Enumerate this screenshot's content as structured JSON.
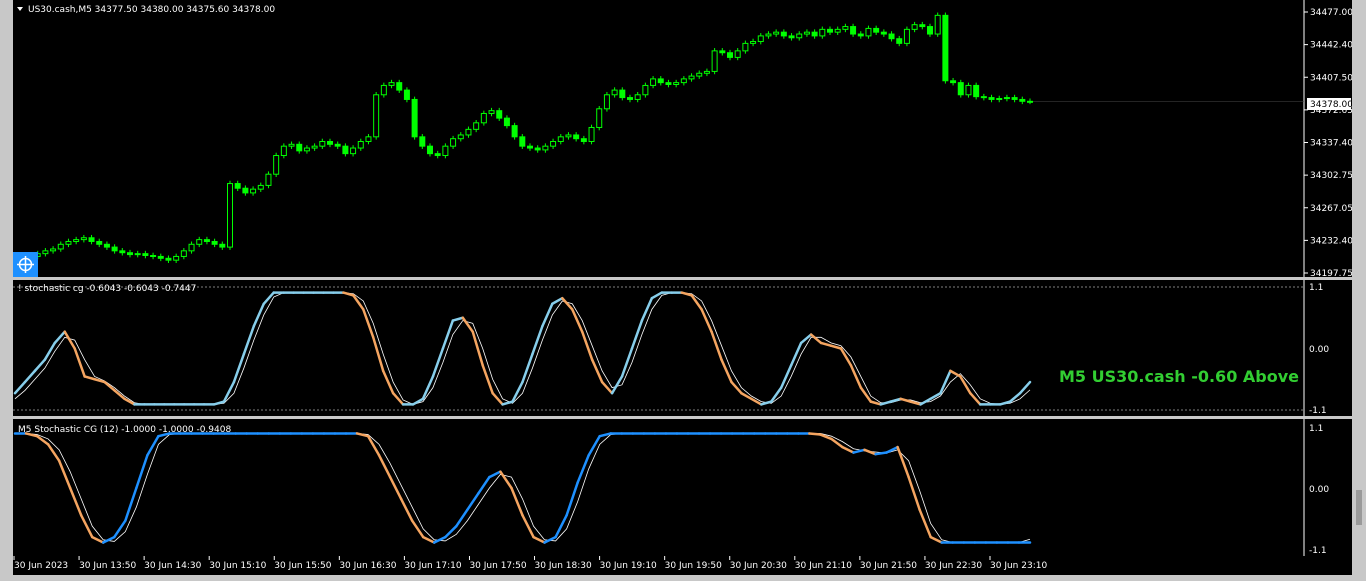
{
  "colors": {
    "background": "#000000",
    "frame": "#c8c8c8",
    "bull_candle": "#00ff00",
    "grid_text": "#ffffff",
    "stoch_main": "#87ceeb",
    "stoch_main_alt": "#1e90ff",
    "stoch_down": "#f4a460",
    "stoch_signal": "#ffffff",
    "signal_text": "#32cd32",
    "widget": "#1e90ff"
  },
  "main_panel": {
    "header": "US30.cash,M5  34377.50 34380.00 34375.60 34378.00",
    "header_icon": "triangle-down-icon",
    "crosshair_icon": "crosshair-icon",
    "price_labels": [
      "34477.00",
      "34442.40",
      "34407.50",
      "34372.65",
      "34337.40",
      "34302.75",
      "34267.05",
      "34232.40",
      "34197.75"
    ],
    "current_price": "34378.00"
  },
  "indicator1": {
    "header": "! stochastic cg -0.6043 -0.6043 -0.7447",
    "levels": [
      "1.1",
      "0.00",
      "-1.1"
    ],
    "signal_text": "M5 US30.cash -0.60 Above"
  },
  "indicator2": {
    "header": "M5 Stochastic CG (12) -1.0000 -1.0000 -0.9408",
    "levels": [
      "1.1",
      "0.00",
      "-1.1"
    ]
  },
  "time_axis": [
    "30 Jun 2023",
    "30 Jun 13:50",
    "30 Jun 14:30",
    "30 Jun 15:10",
    "30 Jun 15:50",
    "30 Jun 16:30",
    "30 Jun 17:10",
    "30 Jun 17:50",
    "30 Jun 18:30",
    "30 Jun 19:10",
    "30 Jun 19:50",
    "30 Jun 20:30",
    "30 Jun 21:10",
    "30 Jun 21:50",
    "30 Jun 22:30",
    "30 Jun 23:10"
  ],
  "chart_data": [
    {
      "type": "candlestick",
      "symbol": "US30.cash",
      "timeframe": "M5",
      "ylim": [
        34190,
        34480
      ],
      "close": [
        34212,
        34215,
        34218,
        34220,
        34225,
        34228,
        34230,
        34232,
        34228,
        34225,
        34222,
        34218,
        34216,
        34214,
        34215,
        34213,
        34212,
        34210,
        34208,
        34212,
        34218,
        34225,
        34230,
        34228,
        34225,
        34222,
        34290,
        34285,
        34280,
        34284,
        34288,
        34300,
        34320,
        34330,
        34332,
        34325,
        34328,
        34330,
        34335,
        34332,
        34330,
        34322,
        34328,
        34335,
        34340,
        34385,
        34395,
        34398,
        34390,
        34380,
        34340,
        34330,
        34322,
        34320,
        34330,
        34338,
        34342,
        34348,
        34355,
        34365,
        34368,
        34360,
        34352,
        34340,
        34330,
        34328,
        34326,
        34330,
        34335,
        34340,
        34342,
        34338,
        34335,
        34350,
        34370,
        34385,
        34390,
        34382,
        34380,
        34385,
        34395,
        34402,
        34398,
        34396,
        34398,
        34402,
        34405,
        34408,
        34410,
        34432,
        34430,
        34425,
        34432,
        34440,
        34442,
        34448,
        34450,
        34452,
        34448,
        34446,
        34450,
        34452,
        34448,
        34455,
        34452,
        34455,
        34458,
        34450,
        34448,
        34456,
        34452,
        34450,
        34445,
        34440,
        34455,
        34460,
        34458,
        34450,
        34470,
        34400,
        34398,
        34385,
        34395,
        34383,
        34382,
        34380,
        34381,
        34382,
        34380,
        34378,
        34378
      ],
      "last": {
        "open": 34377.5,
        "high": 34380.0,
        "low": 34375.6,
        "close": 34378.0
      }
    },
    {
      "type": "line",
      "name": "! stochastic cg",
      "ylim": [
        -1.1,
        1.1
      ],
      "values": {
        "main": -0.6043,
        "signal": -0.6043,
        "trigger": -0.7447
      },
      "series_main": [
        -0.8,
        -0.6,
        -0.4,
        -0.2,
        0.1,
        0.3,
        0.0,
        -0.5,
        -0.55,
        -0.6,
        -0.75,
        -0.9,
        -1.0,
        -1.0,
        -1.0,
        -1.0,
        -1.0,
        -1.0,
        -1.0,
        -1.0,
        -1.0,
        -0.95,
        -0.6,
        -0.1,
        0.4,
        0.8,
        1.0,
        1.0,
        1.0,
        1.0,
        1.0,
        1.0,
        1.0,
        1.0,
        0.95,
        0.7,
        0.2,
        -0.4,
        -0.8,
        -1.0,
        -1.0,
        -0.9,
        -0.5,
        0.0,
        0.5,
        0.55,
        0.3,
        -0.3,
        -0.8,
        -1.0,
        -0.95,
        -0.6,
        -0.1,
        0.4,
        0.8,
        0.9,
        0.7,
        0.3,
        -0.2,
        -0.6,
        -0.8,
        -0.5,
        0.0,
        0.5,
        0.9,
        1.0,
        1.0,
        1.0,
        0.95,
        0.7,
        0.3,
        -0.2,
        -0.6,
        -0.8,
        -0.9,
        -1.0,
        -0.95,
        -0.7,
        -0.3,
        0.1,
        0.25,
        0.1,
        0.05,
        0.0,
        -0.3,
        -0.7,
        -0.95,
        -1.0,
        -0.95,
        -0.9,
        -0.95,
        -1.0,
        -0.9,
        -0.8,
        -0.4,
        -0.5,
        -0.8,
        -1.0,
        -1.0,
        -1.0,
        -0.95,
        -0.8,
        -0.6
      ],
      "series_signal": [
        -0.9,
        -0.75,
        -0.55,
        -0.35,
        -0.05,
        0.2,
        0.15,
        -0.2,
        -0.5,
        -0.58,
        -0.7,
        -0.85,
        -0.97,
        -1.0,
        -1.0,
        -1.0,
        -1.0,
        -1.0,
        -1.0,
        -1.0,
        -1.0,
        -0.98,
        -0.8,
        -0.35,
        0.15,
        0.6,
        0.92,
        1.0,
        1.0,
        1.0,
        1.0,
        1.0,
        1.0,
        1.0,
        0.98,
        0.85,
        0.45,
        -0.1,
        -0.6,
        -0.92,
        -1.0,
        -0.95,
        -0.7,
        -0.25,
        0.25,
        0.5,
        0.45,
        0.0,
        -0.55,
        -0.9,
        -0.98,
        -0.8,
        -0.35,
        0.15,
        0.6,
        0.85,
        0.8,
        0.5,
        0.05,
        -0.4,
        -0.7,
        -0.65,
        -0.25,
        0.25,
        0.7,
        0.95,
        1.0,
        1.0,
        0.98,
        0.85,
        0.5,
        0.05,
        -0.4,
        -0.7,
        -0.85,
        -0.95,
        -0.98,
        -0.85,
        -0.5,
        -0.1,
        0.2,
        0.2,
        0.1,
        0.05,
        -0.15,
        -0.5,
        -0.85,
        -0.97,
        -0.97,
        -0.92,
        -0.92,
        -0.97,
        -0.95,
        -0.85,
        -0.6,
        -0.45,
        -0.65,
        -0.9,
        -0.98,
        -1.0,
        -0.98,
        -0.9,
        -0.74
      ]
    },
    {
      "type": "line",
      "name": "M5 Stochastic CG (12)",
      "ylim": [
        -1.1,
        1.1
      ],
      "values": {
        "main": -1.0,
        "signal": -1.0,
        "trigger": -0.9408
      },
      "series_main": [
        1.0,
        1.0,
        0.95,
        0.8,
        0.5,
        0.0,
        -0.5,
        -0.9,
        -1.0,
        -0.9,
        -0.6,
        0.0,
        0.6,
        0.95,
        1.0,
        1.0,
        1.0,
        1.0,
        1.0,
        1.0,
        1.0,
        1.0,
        1.0,
        1.0,
        1.0,
        1.0,
        1.0,
        1.0,
        1.0,
        1.0,
        1.0,
        1.0,
        0.95,
        0.6,
        0.2,
        -0.2,
        -0.6,
        -0.9,
        -1.0,
        -0.9,
        -0.7,
        -0.4,
        -0.1,
        0.2,
        0.3,
        0.0,
        -0.5,
        -0.9,
        -1.0,
        -0.9,
        -0.5,
        0.1,
        0.6,
        0.95,
        1.0,
        1.0,
        1.0,
        1.0,
        1.0,
        1.0,
        1.0,
        1.0,
        1.0,
        1.0,
        1.0,
        1.0,
        1.0,
        1.0,
        1.0,
        1.0,
        1.0,
        1.0,
        1.0,
        0.98,
        0.9,
        0.75,
        0.65,
        0.7,
        0.62,
        0.65,
        0.75,
        0.2,
        -0.4,
        -0.9,
        -1.0,
        -1.0,
        -1.0,
        -1.0,
        -1.0,
        -1.0,
        -1.0,
        -1.0,
        -1.0
      ],
      "series_signal": [
        1.0,
        1.0,
        0.98,
        0.9,
        0.7,
        0.3,
        -0.2,
        -0.7,
        -0.95,
        -0.98,
        -0.8,
        -0.35,
        0.25,
        0.8,
        0.98,
        1.0,
        1.0,
        1.0,
        1.0,
        1.0,
        1.0,
        1.0,
        1.0,
        1.0,
        1.0,
        1.0,
        1.0,
        1.0,
        1.0,
        1.0,
        1.0,
        1.0,
        0.98,
        0.8,
        0.45,
        0.05,
        -0.35,
        -0.75,
        -0.95,
        -0.97,
        -0.85,
        -0.6,
        -0.3,
        0.0,
        0.25,
        0.2,
        -0.2,
        -0.7,
        -0.95,
        -0.97,
        -0.75,
        -0.25,
        0.35,
        0.8,
        0.98,
        1.0,
        1.0,
        1.0,
        1.0,
        1.0,
        1.0,
        1.0,
        1.0,
        1.0,
        1.0,
        1.0,
        1.0,
        1.0,
        1.0,
        1.0,
        1.0,
        1.0,
        1.0,
        1.0,
        0.95,
        0.85,
        0.72,
        0.68,
        0.66,
        0.64,
        0.7,
        0.5,
        -0.05,
        -0.65,
        -0.95,
        -1.0,
        -1.0,
        -1.0,
        -1.0,
        -1.0,
        -1.0,
        -1.0,
        -0.94
      ]
    }
  ]
}
